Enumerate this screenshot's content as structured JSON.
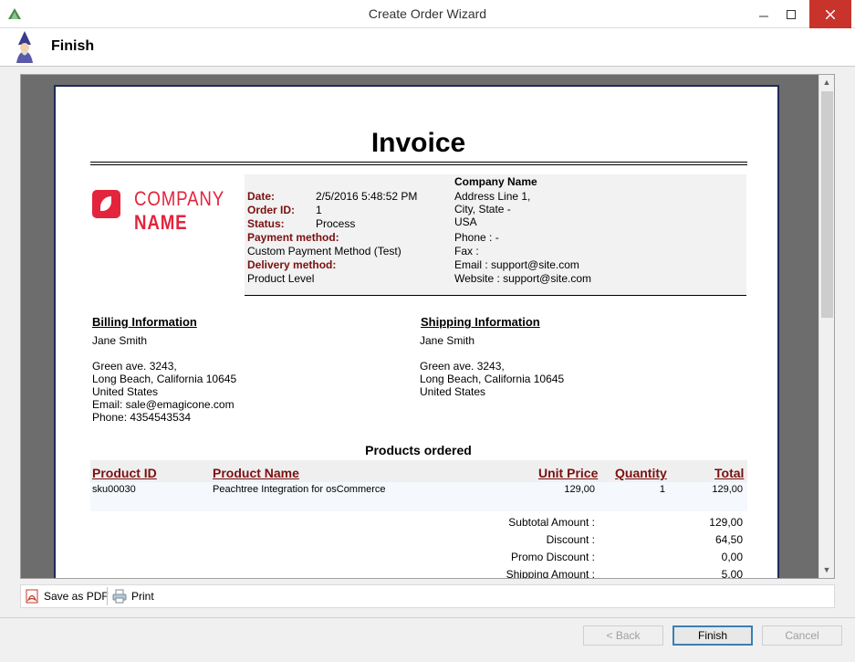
{
  "window": {
    "title": "Create Order Wizard"
  },
  "header": {
    "title": "Finish"
  },
  "invoice": {
    "title": "Invoice",
    "logo": {
      "line1": "COMPANY",
      "line2": "NAME"
    },
    "order": {
      "date_label": "Date:",
      "date_value": "2/5/2016 5:48:52 PM",
      "order_id_label": "Order ID:",
      "order_id_value": "1",
      "status_label": "Status:",
      "status_value": "Process",
      "payment_label": "Payment method:",
      "payment_value": "Custom Payment Method (Test)",
      "delivery_label": "Delivery method:",
      "delivery_value": "Product Level"
    },
    "company": {
      "name": "Company Name",
      "address1": "Address Line 1,",
      "address2": "City, State -",
      "address3": "USA",
      "phone": "Phone : -",
      "fax": "Fax :",
      "email": "Email : support@site.com",
      "website": "Website : support@site.com"
    },
    "billing": {
      "heading": "Billing Information",
      "name": "Jane Smith",
      "street": "Green ave. 3243,",
      "city": "Long Beach, California 10645",
      "country": "United States",
      "email": "Email: sale@emagicone.com",
      "phone": "Phone: 4354543534"
    },
    "shipping": {
      "heading": "Shipping Information",
      "name": "Jane Smith",
      "street": "Green ave. 3243,",
      "city": "Long Beach, California 10645",
      "country": "United States"
    },
    "products": {
      "title": "Products ordered",
      "columns": [
        "Product ID",
        "Product Name",
        "Unit Price",
        "Quantity",
        "Total"
      ],
      "rows": [
        {
          "id": "sku00030",
          "name": "Peachtree Integration for osCommerce",
          "price": "129,00",
          "qty": "1",
          "total": "129,00"
        }
      ]
    },
    "totals": [
      {
        "label": "Subtotal Amount :",
        "value": "129,00"
      },
      {
        "label": "Discount :",
        "value": "64,50"
      },
      {
        "label": "Promo Discount :",
        "value": "0,00"
      },
      {
        "label": "Shipping Amount :",
        "value": "5,00"
      }
    ]
  },
  "toolbar": {
    "save_pdf": "Save as PDF",
    "print": "Print"
  },
  "buttons": {
    "back": "< Back",
    "finish": "Finish",
    "cancel": "Cancel"
  },
  "colors": {
    "accent_red": "#e3243c",
    "label_maroon": "#7a1010",
    "close_button": "#c8342c"
  }
}
